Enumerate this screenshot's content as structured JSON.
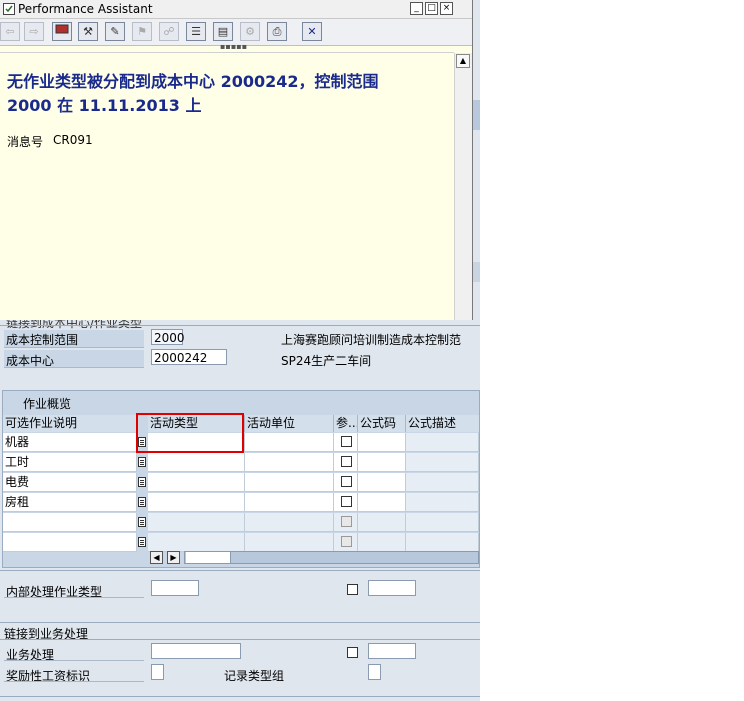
{
  "pa_window": {
    "title": "Performance Assistant",
    "message_line1": "无作业类型被分配到成本中心  2000242，控制范围",
    "message_line2": "2000 在  11.11.2013 上",
    "message_no_label": "消息号",
    "message_no": "CR091",
    "colors": {
      "background": "#ffffe8",
      "message_text": "#1a2a8c"
    }
  },
  "header": {
    "section_title": "链接到成本中心/作业类型",
    "controlling_area_label": "成本控制范围",
    "controlling_area_value": "2000",
    "controlling_area_desc": "上海赛跑顾问培训制造成本控制范",
    "cost_center_label": "成本中心",
    "cost_center_value": "2000242",
    "cost_center_desc": "SP24生产二车间"
  },
  "activity_table": {
    "title": "作业概览",
    "columns": [
      "可选作业说明",
      "活动类型",
      "活动单位",
      "参...",
      "公式码",
      "公式描述"
    ],
    "rows": [
      {
        "desc": "机器",
        "enabled": true
      },
      {
        "desc": "工时",
        "enabled": true
      },
      {
        "desc": "电费",
        "enabled": true
      },
      {
        "desc": "房租",
        "enabled": true
      },
      {
        "desc": "",
        "enabled": false
      },
      {
        "desc": "",
        "enabled": false
      }
    ]
  },
  "internal": {
    "label": "内部处理作业类型"
  },
  "business": {
    "section_title": "链接到业务处理",
    "process_label": "业务处理",
    "bonus_label": "奖励性工资标识",
    "record_type_label": "记录类型组"
  },
  "highlight_color": "#e00000"
}
